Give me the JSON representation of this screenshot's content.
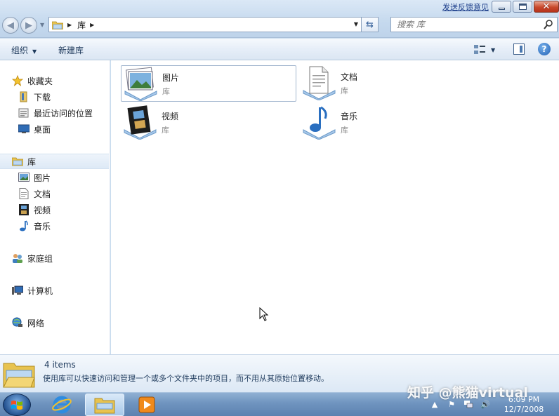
{
  "window": {
    "feedback_link": "发送反馈意见",
    "minimize_icon": "minimize-icon",
    "maximize_icon": "maximize-icon",
    "close_icon": "close-icon"
  },
  "address_bar": {
    "back_icon": "back-arrow-icon",
    "forward_icon": "forward-arrow-icon",
    "crumbs": [
      "库"
    ],
    "refresh_icon": "refresh-icon"
  },
  "search": {
    "placeholder": "搜索 库"
  },
  "toolbar": {
    "organize_label": "组织",
    "new_library_label": "新建库"
  },
  "navigation": {
    "favorites": {
      "label": "收藏夹",
      "items": [
        {
          "label": "下载",
          "icon": "downloads-icon"
        },
        {
          "label": "最近访问的位置",
          "icon": "recent-places-icon"
        },
        {
          "label": "桌面",
          "icon": "desktop-icon"
        }
      ]
    },
    "libraries": {
      "label": "库",
      "items": [
        {
          "label": "图片",
          "icon": "pictures-icon"
        },
        {
          "label": "文档",
          "icon": "documents-icon"
        },
        {
          "label": "视频",
          "icon": "videos-icon"
        },
        {
          "label": "音乐",
          "icon": "music-icon"
        }
      ]
    },
    "homegroup": {
      "label": "家庭组"
    },
    "computer": {
      "label": "计算机"
    },
    "network": {
      "label": "网络"
    }
  },
  "content": {
    "tiles": [
      {
        "name": "图片",
        "type": "库",
        "icon": "pictures-library-icon"
      },
      {
        "name": "文档",
        "type": "库",
        "icon": "documents-library-icon"
      },
      {
        "name": "视频",
        "type": "库",
        "icon": "videos-library-icon"
      },
      {
        "name": "音乐",
        "type": "库",
        "icon": "music-library-icon"
      }
    ]
  },
  "details": {
    "count": "4 items",
    "description": "使用库可以快速访问和管理一个或多个文件夹中的项目，而不用从其原始位置移动。"
  },
  "taskbar": {
    "time": "6:09 PM",
    "date": "12/7/2008"
  },
  "watermark": "知乎 @熊猫virtual"
}
